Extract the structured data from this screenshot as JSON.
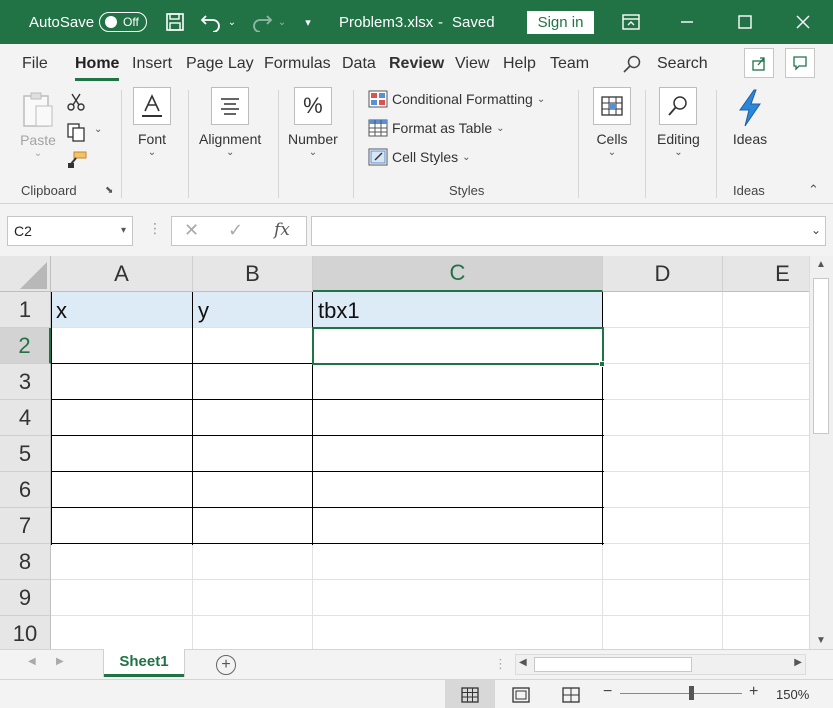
{
  "titlebar": {
    "autosave_label": "AutoSave",
    "autosave_state": "Off",
    "filename": "Problem3.xlsx",
    "separator": "-",
    "save_status": "Saved",
    "signin_label": "Sign in",
    "brand_color": "#217346"
  },
  "tabs": [
    "File",
    "Home",
    "Insert",
    "Page Lay",
    "Formulas",
    "Data",
    "Review",
    "View",
    "Help",
    "Team"
  ],
  "active_tab": "Home",
  "search_label": "Search",
  "ribbon": {
    "clipboard": {
      "paste_label": "Paste",
      "group_label": "Clipboard"
    },
    "font": {
      "label": "Font"
    },
    "alignment": {
      "label": "Alignment"
    },
    "number": {
      "label": "Number"
    },
    "styles": {
      "conditional": "Conditional Formatting",
      "format_table": "Format as Table",
      "cell_styles": "Cell Styles",
      "group_label": "Styles"
    },
    "cells": {
      "label": "Cells"
    },
    "editing": {
      "label": "Editing"
    },
    "ideas": {
      "label": "Ideas",
      "group_label": "Ideas"
    }
  },
  "formula_bar": {
    "name_box": "C2",
    "fx": "fx",
    "formula": ""
  },
  "sheet": {
    "columns": [
      "A",
      "B",
      "C",
      "D",
      "E"
    ],
    "rows": [
      "1",
      "2",
      "3",
      "4",
      "5",
      "6",
      "7",
      "8",
      "9",
      "10"
    ],
    "header_row": [
      "x",
      "y",
      "tbx1"
    ],
    "selected_cell": "C2",
    "selected_column": "C",
    "selected_row": "2",
    "header_fill": "#ddebf7"
  },
  "sheet_tabs": [
    "Sheet1"
  ],
  "status": {
    "zoom": "150%"
  }
}
